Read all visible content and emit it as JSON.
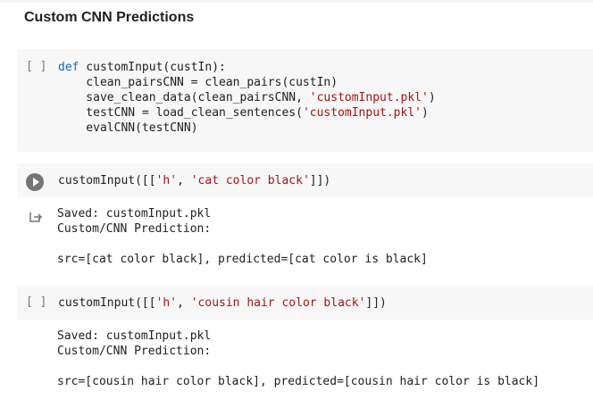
{
  "heading": "Custom CNN Predictions",
  "cells": {
    "def_cell": {
      "bracket": "[ ]",
      "lines": {
        "l1_kw": "def",
        "l1_rest": " customInput(custIn):",
        "l2": "  clean_pairsCNN = clean_pairs(custIn)",
        "l3_a": "  save_clean_data(clean_pairsCNN, ",
        "l3_str": "'customInput.pkl'",
        "l3_b": ")",
        "l4_a": "  testCNN = load_clean_sentences(",
        "l4_str": "'customInput.pkl'",
        "l4_b": ")",
        "l5": "  evalCNN(testCNN)"
      }
    },
    "run_cell_1": {
      "code_a": "customInput([[",
      "str1": "'h'",
      "sep": ", ",
      "str2": "'cat color black'",
      "code_b": "]])",
      "output": {
        "line1": "Saved: customInput.pkl",
        "line2": "Custom/CNN Prediction:",
        "line3": "src=[cat color black], predicted=[cat color is black]"
      }
    },
    "run_cell_2": {
      "bracket": "[ ]",
      "code_a": "customInput([[",
      "str1": "'h'",
      "sep": ", ",
      "str2": "'cousin hair color black'",
      "code_b": "]])",
      "output": {
        "line1": "Saved: customInput.pkl",
        "line2": "Custom/CNN Prediction:",
        "line3": "src=[cousin hair color black], predicted=[cousin hair color is black]"
      }
    }
  },
  "icons": {
    "run": "play-circle-icon",
    "output": "output-arrow-icon"
  },
  "colors": {
    "keyword": "#1565c0",
    "string": "#a31515",
    "cell_bg": "#f7f7f7"
  }
}
